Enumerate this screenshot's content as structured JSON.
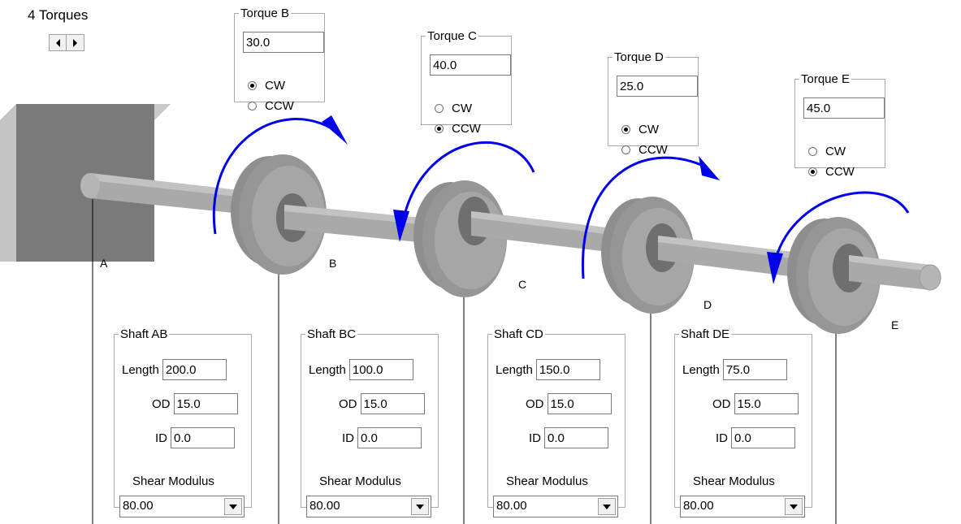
{
  "title": "4 Torques",
  "colors": {
    "arrow": "#0000ee",
    "shaft": "#a8a8a8",
    "disk": "#9a9a9a",
    "wall": "#7a7a7a"
  },
  "icons": {
    "prev": "left-triangle-icon",
    "next": "right-triangle-icon",
    "dropdown": "chevron-down-icon"
  },
  "points": {
    "A": "A",
    "B": "B",
    "C": "C",
    "D": "D",
    "E": "E"
  },
  "torques": [
    {
      "legend": "Torque B",
      "value": "30.0",
      "cw_label": "CW",
      "ccw_label": "CCW",
      "direction": "CW"
    },
    {
      "legend": "Torque C",
      "value": "40.0",
      "cw_label": "CW",
      "ccw_label": "CCW",
      "direction": "CCW"
    },
    {
      "legend": "Torque D",
      "value": "25.0",
      "cw_label": "CW",
      "ccw_label": "CCW",
      "direction": "CW"
    },
    {
      "legend": "Torque E",
      "value": "45.0",
      "cw_label": "CW",
      "ccw_label": "CCW",
      "direction": "CCW"
    }
  ],
  "shafts": [
    {
      "legend": "Shaft AB",
      "length_label": "Length",
      "length": "200.0",
      "od_label": "OD",
      "od": "15.0",
      "id_label": "ID",
      "id": "0.0",
      "modulus_label": "Shear Modulus",
      "modulus": "80.00"
    },
    {
      "legend": "Shaft BC",
      "length_label": "Length",
      "length": "100.0",
      "od_label": "OD",
      "od": "15.0",
      "id_label": "ID",
      "id": "0.0",
      "modulus_label": "Shear Modulus",
      "modulus": "80.00"
    },
    {
      "legend": "Shaft CD",
      "length_label": "Length",
      "length": "150.0",
      "od_label": "OD",
      "od": "15.0",
      "id_label": "ID",
      "id": "0.0",
      "modulus_label": "Shear Modulus",
      "modulus": "80.00"
    },
    {
      "legend": "Shaft DE",
      "length_label": "Length",
      "length": "75.0",
      "od_label": "OD",
      "od": "15.0",
      "id_label": "ID",
      "id": "0.0",
      "modulus_label": "Shear Modulus",
      "modulus": "80.00"
    }
  ]
}
